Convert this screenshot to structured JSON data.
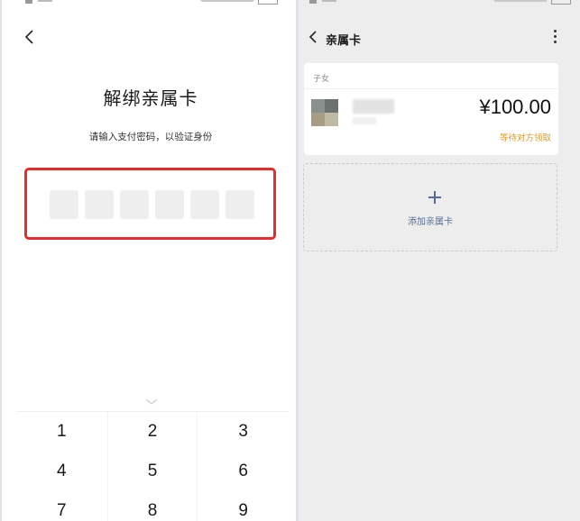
{
  "left_screen": {
    "title": "解绑亲属卡",
    "subtitle": "请输入支付密码，以验证身份",
    "pin_length": 6,
    "keypad_keys": [
      "1",
      "2",
      "3",
      "4",
      "5",
      "6",
      "7",
      "8",
      "9"
    ]
  },
  "right_screen": {
    "title": "亲属卡",
    "card": {
      "relation": "子女",
      "amount": "¥100.00",
      "status": "等待对方领取"
    },
    "add_card_label": "添加亲属卡"
  },
  "colors": {
    "highlight_border": "#e52b2b",
    "link_blue": "#576b95",
    "status_orange": "#d99b2a"
  }
}
